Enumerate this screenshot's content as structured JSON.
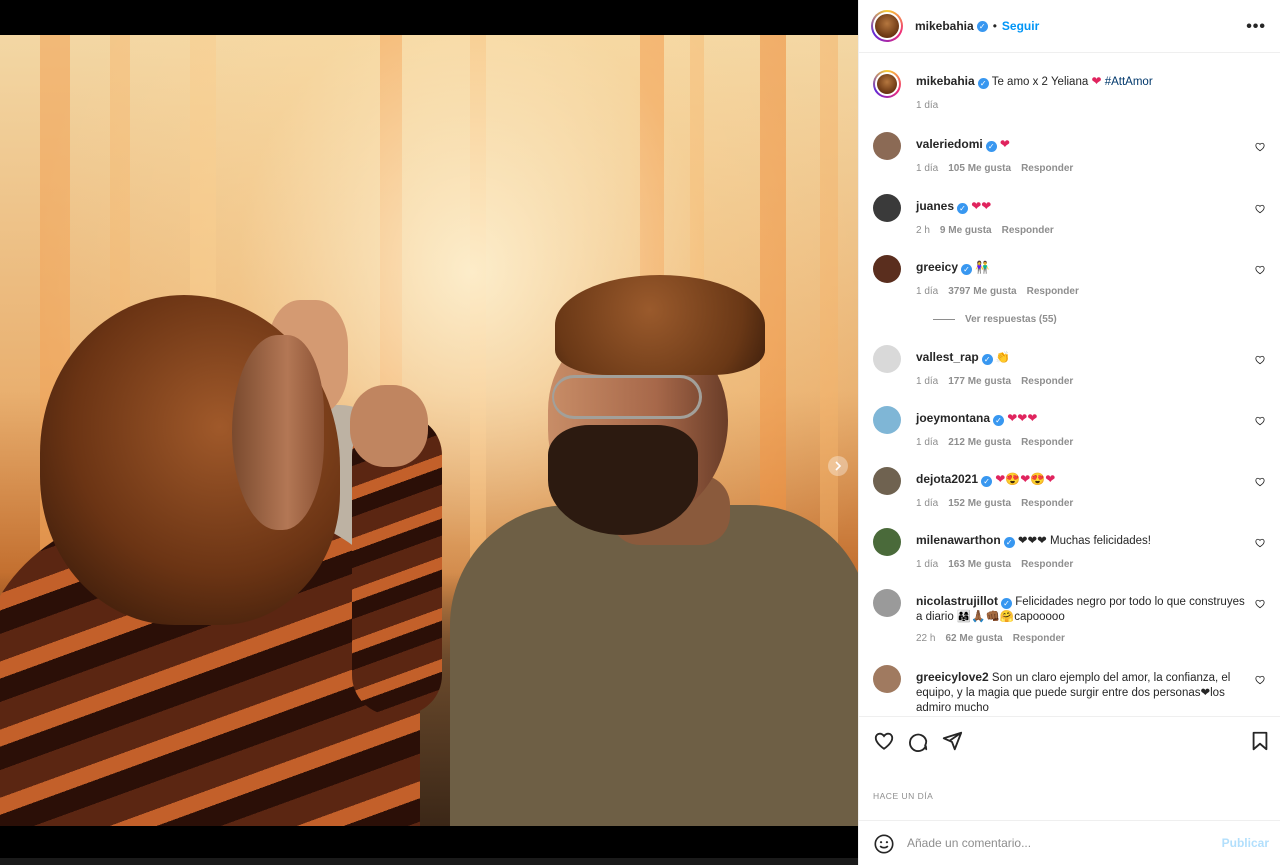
{
  "post": {
    "author": "mikebahia",
    "follow_label": "Seguir",
    "more_label": "•••",
    "caption_user": "mikebahia",
    "caption_text": "Te amo x 2 Yeliana",
    "caption_heart": "❤",
    "caption_hashtag": "#AttAmor",
    "caption_time": "1 día",
    "time_ago": "HACE UN DÍA"
  },
  "comments": [
    {
      "user": "valeriedomi",
      "text": "❤",
      "time": "1 día",
      "likes": "105 Me gusta",
      "reply": "Responder"
    },
    {
      "user": "juanes",
      "text": "❤❤",
      "time": "2 h",
      "likes": "9 Me gusta",
      "reply": "Responder"
    },
    {
      "user": "greeicy",
      "text": "👫",
      "time": "1 día",
      "likes": "3797 Me gusta",
      "reply": "Responder",
      "view_replies": "Ver respuestas (55)"
    },
    {
      "user": "vallest_rap",
      "text": "👏",
      "time": "1 día",
      "likes": "177 Me gusta",
      "reply": "Responder"
    },
    {
      "user": "joeymontana",
      "text": "❤❤❤",
      "time": "1 día",
      "likes": "212 Me gusta",
      "reply": "Responder"
    },
    {
      "user": "dejota2021",
      "text": "❤😍❤😍❤",
      "time": "1 día",
      "likes": "152 Me gusta",
      "reply": "Responder"
    },
    {
      "user": "milenawarthon",
      "text": "❤❤❤ Muchas felicidades!",
      "time": "1 día",
      "likes": "163 Me gusta",
      "reply": "Responder"
    },
    {
      "user": "nicolastrujillot",
      "text": "Felicidades negro por todo lo que construyes a diario 👨‍👩‍👧🙏🏾👊🏾🤗capooooo",
      "time": "22 h",
      "likes": "62 Me gusta",
      "reply": "Responder"
    },
    {
      "user": "greeicylove2",
      "text": "Son un claro ejemplo del amor, la confianza, el equipo, y la magia que puede surgir entre dos personas❤los admiro mucho",
      "time": "",
      "likes": "",
      "reply": ""
    }
  ],
  "composer": {
    "placeholder": "Añade un comentario...",
    "post_label": "Publicar"
  },
  "carousel": {
    "slides": 4,
    "active": 0
  },
  "colors": {
    "accent": "#0095f6",
    "verified": "#3897f0",
    "heart": "#e0245e"
  }
}
